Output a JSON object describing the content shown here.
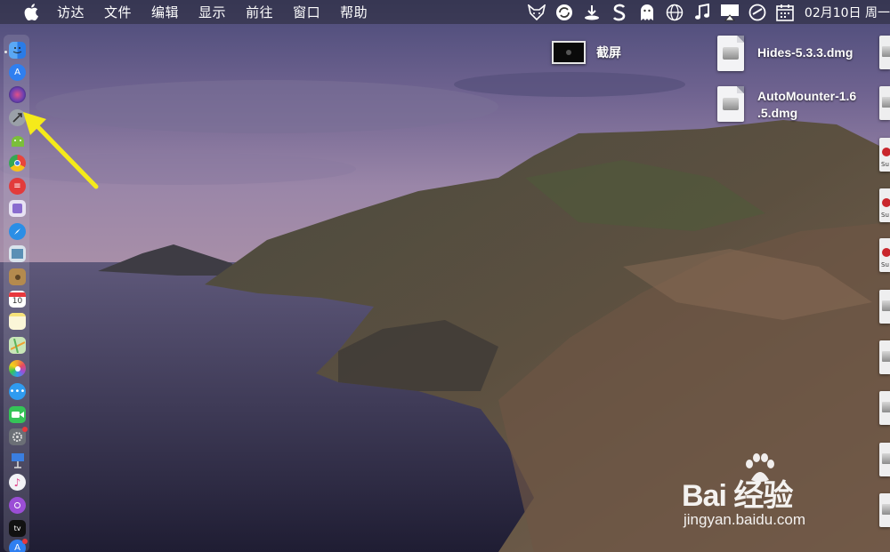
{
  "menubar": {
    "apple_icon": "apple-logo-icon",
    "items": [
      "访达",
      "文件",
      "编辑",
      "显示",
      "前往",
      "窗口",
      "帮助"
    ],
    "status_icons": [
      "fox-icon",
      "sync-icon",
      "download-icon",
      "s-app-icon",
      "ghost-icon",
      "globe-icon",
      "music-note-icon",
      "airplay-icon",
      "compass-icon",
      "calendar-icon"
    ],
    "clock": "02月10日 周一"
  },
  "dock": {
    "apps": [
      {
        "name": "finder-icon",
        "color": "#3c8ef0"
      },
      {
        "name": "app-store-icon",
        "color": "#2f7ff0"
      },
      {
        "name": "siri-icon",
        "color": "#6a3fb0"
      },
      {
        "name": "launchpad-icon",
        "color": "#9aa0a8"
      },
      {
        "name": "android-icon",
        "color": "#7bbf3a"
      },
      {
        "name": "chrome-icon",
        "color": "#e8453c"
      },
      {
        "name": "red-app-icon",
        "color": "#e23b3b"
      },
      {
        "name": "purple-app-icon",
        "color": "#8a6ccf"
      },
      {
        "name": "safari-icon",
        "color": "#2a8ee6"
      },
      {
        "name": "preview-icon",
        "color": "#5a8fb5"
      },
      {
        "name": "contacts-icon",
        "color": "#b48a4e"
      },
      {
        "name": "calendar-icon",
        "color": "#ffffff"
      },
      {
        "name": "notes-icon",
        "color": "#f6e27a"
      },
      {
        "name": "maps-icon",
        "color": "#5cb35a"
      },
      {
        "name": "photos-icon",
        "color": "#f0a030"
      },
      {
        "name": "messages-icon",
        "color": "#2f9bf0"
      },
      {
        "name": "facetime-icon",
        "color": "#35c457"
      },
      {
        "name": "system-preferences-icon",
        "color": "#6b6f76"
      },
      {
        "name": "keynote-icon",
        "color": "#3a7ee0"
      },
      {
        "name": "itunes-icon",
        "color": "#e8e8ee"
      },
      {
        "name": "podcasts-icon",
        "color": "#9b4ed6"
      },
      {
        "name": "apple-tv-icon",
        "color": "#111111"
      },
      {
        "name": "app-store-2-icon",
        "color": "#2f7ff0"
      }
    ],
    "calendar_day": "10",
    "apple_tv_label": "tv"
  },
  "desktop": {
    "screenshot_label": "截屏",
    "files": [
      {
        "label": "Hides-5.3.3.dmg"
      },
      {
        "label_line1": "AutoMounter-1.6",
        "label_line2": ".5.dmg"
      }
    ],
    "edge_icon_text": "Su"
  },
  "watermark": {
    "logo": "Bai 经验",
    "url": "jingyan.baidu.com"
  },
  "annotation": {
    "color": "#f5ea1a"
  }
}
